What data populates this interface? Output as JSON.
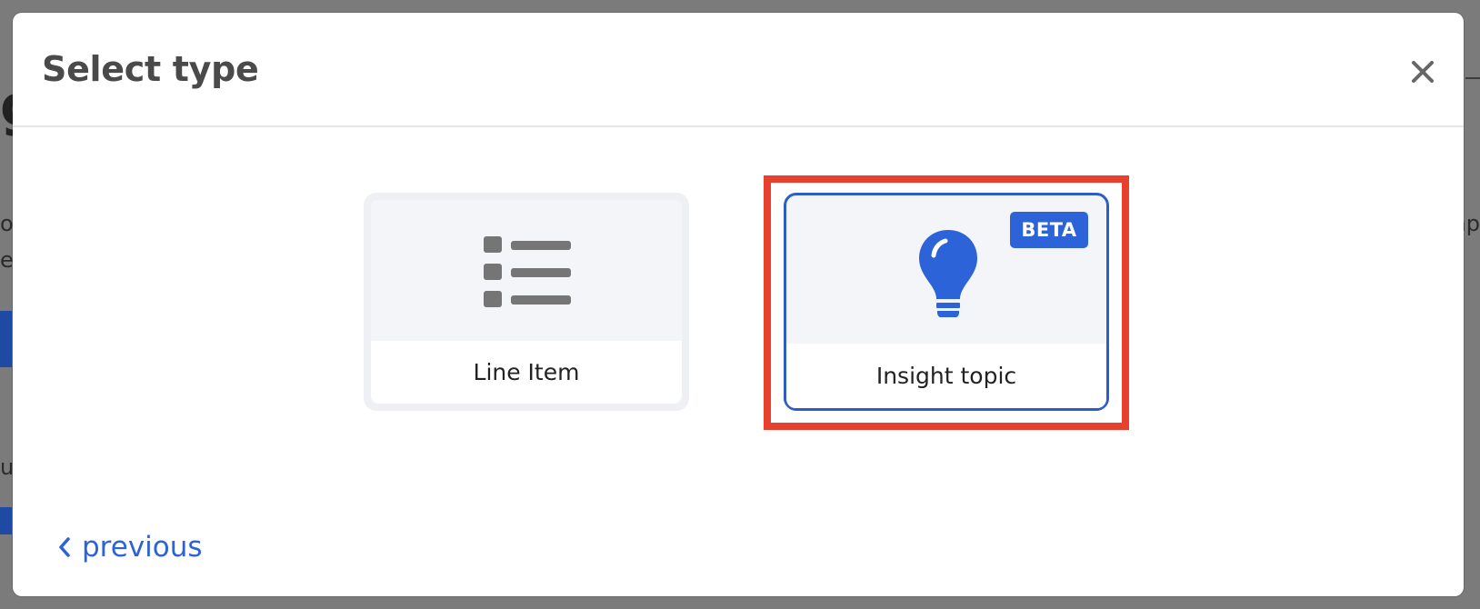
{
  "modal": {
    "title": "Select type",
    "close_icon": "close-icon"
  },
  "cards": [
    {
      "label": "Line Item",
      "icon": "list-icon",
      "selected": false
    },
    {
      "label": "Insight topic",
      "icon": "lightbulb-icon",
      "badge": "BETA",
      "selected": true
    }
  ],
  "footer": {
    "previous_label": "previous",
    "previous_icon": "chevron-left-icon"
  },
  "colors": {
    "accent": "#2d63d8",
    "highlight": "#e8402c",
    "card_bg": "#f4f5f8",
    "title": "#4a4a4a"
  }
}
